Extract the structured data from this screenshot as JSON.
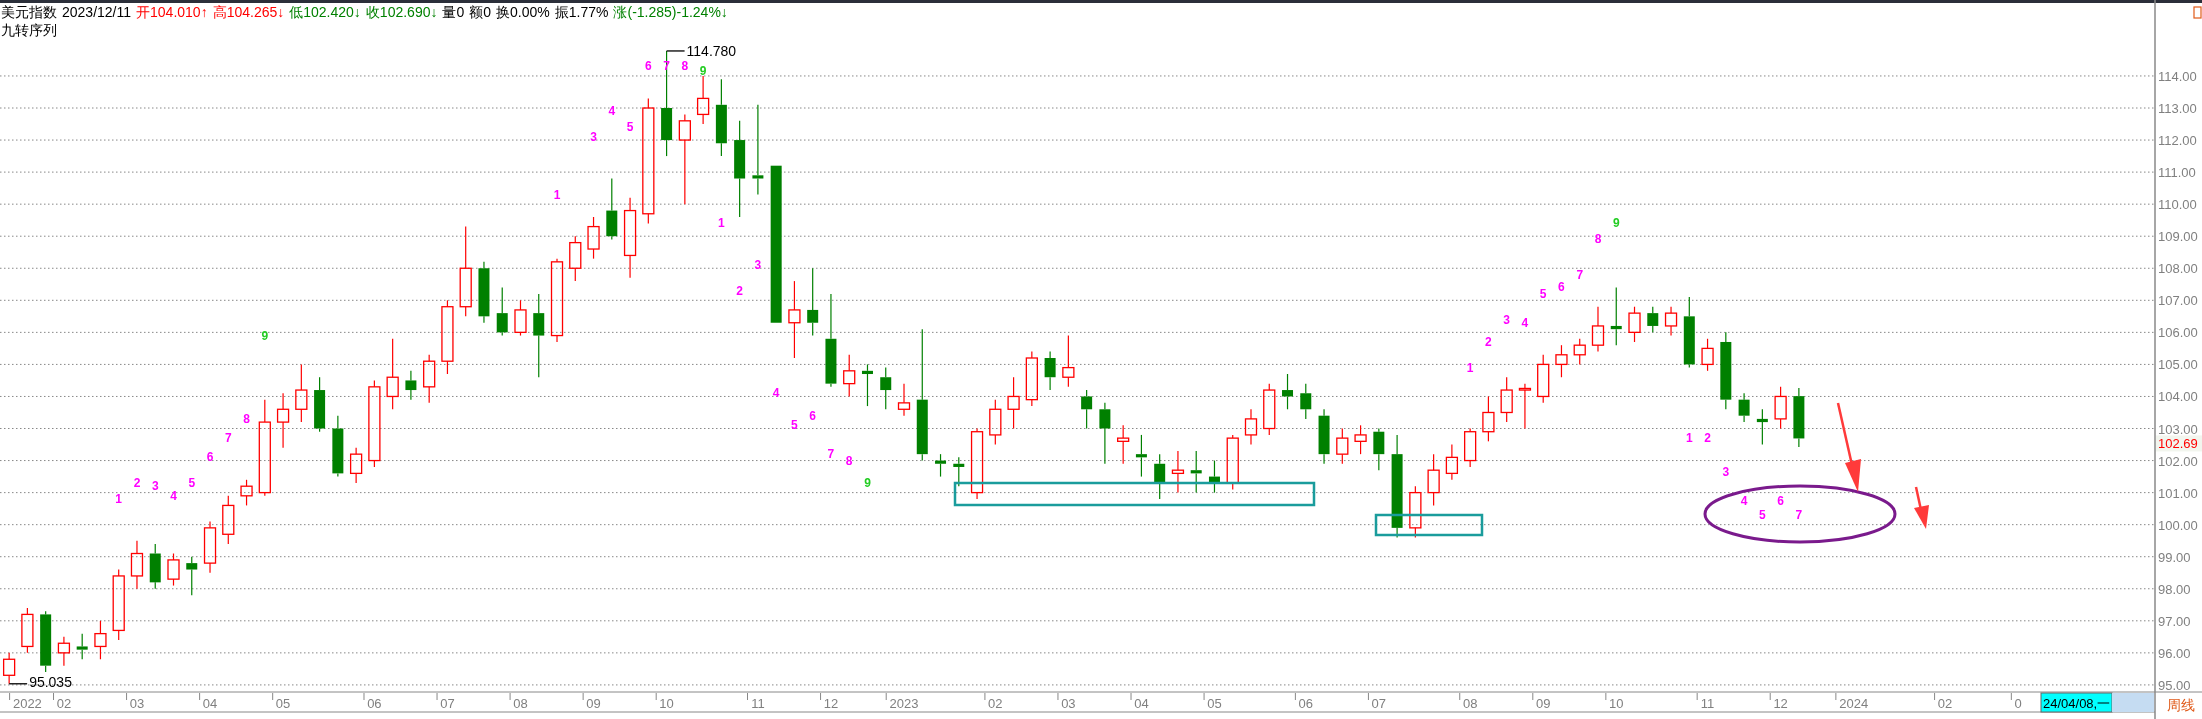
{
  "header": {
    "items": [
      {
        "text": "美元指数",
        "color": "#000000"
      },
      {
        "text": "2023/12/11",
        "color": "#000000"
      },
      {
        "text": "开104.010↑",
        "color": "#ff0000"
      },
      {
        "text": "高104.265↓",
        "color": "#ff0000"
      },
      {
        "text": "低102.420↓",
        "color": "#008000"
      },
      {
        "text": "收102.690↓",
        "color": "#008000"
      },
      {
        "text": "量0",
        "color": "#000000"
      },
      {
        "text": "额0",
        "color": "#000000"
      },
      {
        "text": "换0.00%",
        "color": "#000000"
      },
      {
        "text": "振1.77%",
        "color": "#000000"
      },
      {
        "text": "涨(-1.285)-1.24%↓",
        "color": "#008000"
      }
    ],
    "indicator": "九转序列"
  },
  "chart_data": {
    "type": "candlestick",
    "grid": true,
    "ylim": [
      94.81,
      116.37
    ],
    "yticks": [
      {
        "value": 114,
        "label": "114.00"
      },
      {
        "value": 113,
        "label": "113.00"
      },
      {
        "value": 112,
        "label": "112.00"
      },
      {
        "value": 111,
        "label": "111.00"
      },
      {
        "value": 110,
        "label": "110.00"
      },
      {
        "value": 109,
        "label": "109.00"
      },
      {
        "value": 108,
        "label": "108.00"
      },
      {
        "value": 107,
        "label": "107.00"
      },
      {
        "value": 106,
        "label": "106.00"
      },
      {
        "value": 105,
        "label": "105.00"
      },
      {
        "value": 104,
        "label": "104.00"
      },
      {
        "value": 103,
        "label": "103.00"
      },
      {
        "value": 102,
        "label": "102.00"
      },
      {
        "value": 101,
        "label": "101.00"
      },
      {
        "value": 100,
        "label": "100.00"
      },
      {
        "value": 99,
        "label": "99.00"
      },
      {
        "value": 98,
        "label": "98.00"
      },
      {
        "value": 97,
        "label": "97.00"
      },
      {
        "value": 96,
        "label": "96.00"
      },
      {
        "value": 95,
        "label": "95.00"
      }
    ],
    "categories": [
      null,
      "2022",
      null,
      "02",
      null,
      null,
      null,
      "03",
      null,
      null,
      null,
      "04",
      null,
      null,
      null,
      "05",
      null,
      null,
      null,
      null,
      "06",
      null,
      null,
      null,
      "07",
      null,
      null,
      null,
      "08",
      null,
      null,
      null,
      "09",
      null,
      null,
      null,
      "10",
      null,
      null,
      null,
      null,
      "11",
      null,
      null,
      null,
      "12",
      null,
      null,
      null,
      "2023",
      null,
      null,
      null,
      null,
      "02",
      null,
      null,
      null,
      "03",
      null,
      null,
      null,
      "04",
      null,
      null,
      null,
      "05",
      null,
      null,
      null,
      null,
      "06",
      null,
      null,
      null,
      "07",
      null,
      null,
      null,
      null,
      "08",
      null,
      null,
      null,
      "09",
      null,
      null,
      null,
      "10",
      null,
      null,
      null,
      null,
      "11",
      null,
      null,
      null,
      "12",
      null,
      null,
      null,
      "2024",
      null,
      null,
      null,
      null,
      "02",
      null,
      null,
      null,
      "0",
      null,
      null,
      null,
      null,
      null,
      null,
      null
    ],
    "ohlc": [
      [
        95.3,
        96.0,
        95.035,
        95.8
      ],
      [
        96.2,
        97.4,
        96.0,
        97.2
      ],
      [
        97.2,
        97.3,
        95.4,
        95.6
      ],
      [
        96.0,
        96.5,
        95.6,
        96.3
      ],
      [
        96.2,
        96.6,
        95.8,
        96.1
      ],
      [
        96.2,
        97.0,
        95.8,
        96.6
      ],
      [
        96.7,
        98.6,
        96.4,
        98.4
      ],
      [
        98.4,
        99.5,
        98.0,
        99.1
      ],
      [
        99.1,
        99.4,
        98.0,
        98.2
      ],
      [
        98.3,
        99.1,
        98.1,
        98.9
      ],
      [
        98.8,
        99.0,
        97.8,
        98.6
      ],
      [
        98.8,
        100.1,
        98.5,
        99.9
      ],
      [
        99.7,
        100.9,
        99.4,
        100.6
      ],
      [
        100.9,
        101.4,
        100.6,
        101.2
      ],
      [
        101.0,
        103.9,
        100.9,
        103.2
      ],
      [
        103.2,
        104.1,
        102.4,
        103.6
      ],
      [
        103.6,
        105.0,
        103.2,
        104.2
      ],
      [
        104.2,
        104.6,
        102.9,
        103.0
      ],
      [
        103.0,
        103.4,
        101.5,
        101.6
      ],
      [
        101.6,
        102.4,
        101.3,
        102.2
      ],
      [
        102.0,
        104.5,
        101.8,
        104.3
      ],
      [
        104.0,
        105.8,
        103.6,
        104.6
      ],
      [
        104.5,
        104.8,
        103.9,
        104.2
      ],
      [
        104.3,
        105.3,
        103.8,
        105.1
      ],
      [
        105.1,
        107.0,
        104.7,
        106.8
      ],
      [
        106.8,
        109.3,
        106.5,
        108.0
      ],
      [
        108.0,
        108.2,
        106.3,
        106.5
      ],
      [
        106.6,
        107.4,
        105.9,
        106.0
      ],
      [
        106.0,
        107.0,
        105.9,
        106.7
      ],
      [
        106.6,
        107.2,
        104.6,
        105.9
      ],
      [
        105.9,
        108.3,
        105.7,
        108.2
      ],
      [
        108.0,
        109.0,
        107.6,
        108.8
      ],
      [
        108.6,
        109.6,
        108.3,
        109.3
      ],
      [
        109.8,
        110.8,
        108.9,
        109.0
      ],
      [
        108.4,
        110.2,
        107.7,
        109.8
      ],
      [
        109.7,
        113.3,
        109.4,
        113.0
      ],
      [
        113.0,
        114.78,
        111.5,
        112.0
      ],
      [
        112.0,
        112.8,
        110.0,
        112.6
      ],
      [
        112.8,
        114.0,
        112.5,
        113.3
      ],
      [
        113.1,
        113.9,
        111.5,
        111.9
      ],
      [
        112.0,
        112.6,
        109.6,
        110.8
      ],
      [
        110.9,
        113.1,
        110.3,
        110.8
      ],
      [
        111.2,
        111.2,
        106.3,
        106.3
      ],
      [
        106.3,
        107.6,
        105.2,
        106.7
      ],
      [
        106.7,
        108.0,
        105.9,
        106.3
      ],
      [
        105.8,
        107.2,
        104.3,
        104.4
      ],
      [
        104.4,
        105.3,
        104.0,
        104.8
      ],
      [
        104.8,
        105.0,
        103.7,
        104.7
      ],
      [
        104.6,
        104.9,
        103.6,
        104.2
      ],
      [
        103.6,
        104.4,
        103.4,
        103.8
      ],
      [
        103.9,
        106.1,
        102.0,
        102.2
      ],
      [
        102.0,
        102.2,
        101.5,
        101.9
      ],
      [
        101.9,
        102.1,
        101.2,
        101.8
      ],
      [
        101.0,
        103.0,
        100.8,
        102.9
      ],
      [
        102.8,
        103.9,
        102.5,
        103.6
      ],
      [
        103.6,
        104.6,
        103.0,
        104.0
      ],
      [
        103.9,
        105.4,
        103.7,
        105.2
      ],
      [
        105.2,
        105.4,
        104.2,
        104.6
      ],
      [
        104.6,
        105.9,
        104.3,
        104.9
      ],
      [
        104.0,
        104.2,
        103.0,
        103.6
      ],
      [
        103.6,
        103.8,
        101.9,
        103.0
      ],
      [
        102.6,
        103.1,
        101.9,
        102.7
      ],
      [
        102.2,
        102.8,
        101.5,
        102.1
      ],
      [
        101.9,
        102.2,
        100.8,
        101.3
      ],
      [
        101.6,
        102.3,
        101.0,
        101.7
      ],
      [
        101.7,
        102.3,
        101.0,
        101.6
      ],
      [
        101.5,
        102.0,
        101.0,
        101.3
      ],
      [
        101.3,
        102.8,
        101.1,
        102.7
      ],
      [
        102.8,
        103.6,
        102.5,
        103.3
      ],
      [
        103.0,
        104.4,
        102.8,
        104.2
      ],
      [
        104.2,
        104.7,
        103.6,
        104.0
      ],
      [
        104.1,
        104.4,
        103.3,
        103.6
      ],
      [
        103.4,
        103.6,
        101.9,
        102.2
      ],
      [
        102.2,
        103.0,
        101.9,
        102.7
      ],
      [
        102.6,
        103.1,
        102.2,
        102.8
      ],
      [
        102.9,
        103.0,
        101.7,
        102.2
      ],
      [
        102.2,
        102.8,
        99.6,
        99.9
      ],
      [
        99.9,
        101.2,
        99.6,
        101.0
      ],
      [
        101.0,
        102.2,
        100.6,
        101.7
      ],
      [
        101.6,
        102.5,
        101.4,
        102.1
      ],
      [
        102.0,
        103.0,
        101.8,
        102.9
      ],
      [
        102.9,
        104.0,
        102.6,
        103.5
      ],
      [
        103.5,
        104.6,
        103.2,
        104.2
      ],
      [
        104.2,
        104.4,
        103.0,
        104.25
      ],
      [
        104.0,
        105.3,
        103.8,
        105.0
      ],
      [
        105.0,
        105.6,
        104.6,
        105.3
      ],
      [
        105.3,
        105.8,
        105.0,
        105.6
      ],
      [
        105.6,
        106.8,
        105.4,
        106.2
      ],
      [
        106.2,
        107.4,
        105.6,
        106.1
      ],
      [
        106.0,
        106.8,
        105.7,
        106.6
      ],
      [
        106.6,
        106.8,
        106.0,
        106.2
      ],
      [
        106.2,
        106.8,
        105.9,
        106.6
      ],
      [
        106.5,
        107.1,
        104.9,
        105.0
      ],
      [
        105.0,
        105.8,
        104.8,
        105.5
      ],
      [
        105.7,
        106.0,
        103.6,
        103.9
      ],
      [
        103.9,
        104.1,
        103.2,
        103.4
      ],
      [
        103.3,
        103.6,
        102.5,
        103.2
      ],
      [
        103.3,
        104.3,
        103.0,
        104.0
      ],
      [
        104.01,
        104.265,
        102.42,
        102.69
      ],
      null,
      null,
      null,
      null,
      null,
      null,
      null,
      null,
      null,
      null,
      null,
      null,
      null,
      null,
      null,
      null,
      null,
      null,
      null
    ]
  },
  "sequence_counts": [
    {
      "text": "1",
      "color": "#ff00ff"
    },
    {
      "text": "2",
      "color": "#ff00ff"
    },
    {
      "text": "3",
      "color": "#ff00ff"
    },
    {
      "text": "4",
      "color": "#ff00ff"
    },
    {
      "text": "5",
      "color": "#ff00ff"
    },
    {
      "text": "6",
      "color": "#ff00ff"
    },
    {
      "text": "7",
      "color": "#ff00ff"
    },
    {
      "text": "8",
      "color": "#ff00ff"
    },
    {
      "text": "9",
      "color": "#22cc22"
    },
    {
      "text": "1",
      "color": "#ff00ff"
    },
    {
      "text": "3",
      "color": "#ff00ff"
    },
    {
      "text": "4",
      "color": "#ff00ff"
    },
    {
      "text": "5",
      "color": "#ff00ff"
    },
    {
      "text": "6",
      "color": "#ff00ff"
    },
    {
      "text": "7",
      "color": "#ff00ff"
    },
    {
      "text": "8",
      "color": "#ff00ff"
    },
    {
      "text": "9",
      "color": "#22cc22"
    },
    {
      "text": "1",
      "color": "#ff00ff"
    },
    {
      "text": "2",
      "color": "#ff00ff"
    },
    {
      "text": "3",
      "color": "#ff00ff"
    },
    {
      "text": "4",
      "color": "#ff00ff"
    },
    {
      "text": "5",
      "color": "#ff00ff"
    },
    {
      "text": "6",
      "color": "#ff00ff"
    },
    {
      "text": "7",
      "color": "#ff00ff"
    },
    {
      "text": "8",
      "color": "#ff00ff"
    },
    {
      "text": "9",
      "color": "#22cc22"
    },
    {
      "text": "1",
      "color": "#ff00ff"
    },
    {
      "text": "2",
      "color": "#ff00ff"
    },
    {
      "text": "3",
      "color": "#ff00ff"
    },
    {
      "text": "4",
      "color": "#ff00ff"
    },
    {
      "text": "5",
      "color": "#ff00ff"
    },
    {
      "text": "6",
      "color": "#ff00ff"
    },
    {
      "text": "7",
      "color": "#ff00ff"
    },
    {
      "text": "8",
      "color": "#ff00ff"
    },
    {
      "text": "9",
      "color": "#22cc22"
    },
    {
      "text": "1",
      "color": "#ff00ff"
    },
    {
      "text": "2",
      "color": "#ff00ff"
    },
    {
      "text": "3",
      "color": "#ff00ff"
    },
    {
      "text": "4",
      "color": "#ff00ff"
    },
    {
      "text": "5",
      "color": "#ff00ff"
    },
    {
      "text": "6",
      "color": "#ff00ff"
    },
    {
      "text": "7",
      "color": "#ff00ff"
    }
  ],
  "high_label": "114.780",
  "low_label": "95.035",
  "last_price_label": "102.69",
  "cursor_date": "24/04/08,一",
  "period": "周线"
}
